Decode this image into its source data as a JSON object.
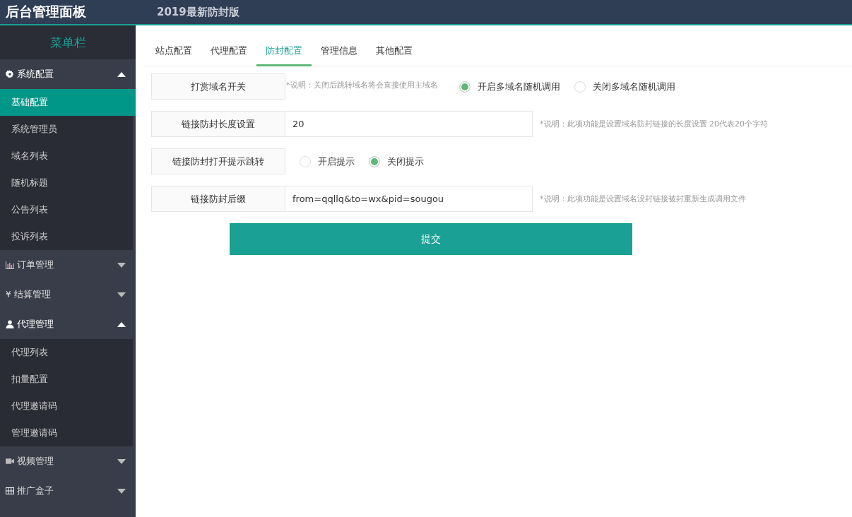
{
  "header": {
    "title": "后台管理面板",
    "subtitle": "2019最新防封版"
  },
  "sidebar": {
    "title": "菜单栏",
    "groups": [
      {
        "label": "系统配置",
        "kind": "gear",
        "expanded": true,
        "items": [
          {
            "label": "基础配置",
            "selected": true
          },
          {
            "label": "系统管理员",
            "selected": false
          },
          {
            "label": "域名列表",
            "selected": false
          },
          {
            "label": "随机标题",
            "selected": false
          },
          {
            "label": "公告列表",
            "selected": false
          },
          {
            "label": "投诉列表",
            "selected": false
          }
        ]
      },
      {
        "label": "订单管理",
        "kind": "chart",
        "expanded": false
      },
      {
        "label": "结算管理",
        "kind": "glyph",
        "glyph": "¥",
        "expanded": false
      },
      {
        "label": "代理管理",
        "kind": "user",
        "expanded": true,
        "items": [
          {
            "label": "代理列表",
            "selected": false
          },
          {
            "label": "扣量配置",
            "selected": false
          },
          {
            "label": "代理邀请码",
            "selected": false
          },
          {
            "label": "管理邀请码",
            "selected": false
          }
        ]
      },
      {
        "label": "视频管理",
        "kind": "video",
        "expanded": false
      },
      {
        "label": "推广盒子",
        "kind": "grid",
        "expanded": false
      }
    ]
  },
  "tabs": [
    {
      "label": "站点配置",
      "selected": false
    },
    {
      "label": "代理配置",
      "selected": false
    },
    {
      "label": "防封配置",
      "selected": true
    },
    {
      "label": "管理信息",
      "selected": false
    },
    {
      "label": "其他配置",
      "selected": false
    }
  ],
  "form": [
    {
      "kind": "radio",
      "label": "打赏域名开关",
      "note": "*说明：关闭后跳转域名将会直接使用主域名",
      "options": [
        {
          "label": "开启多域名随机调用",
          "selected": true
        },
        {
          "label": "关闭多域名随机调用",
          "selected": false
        }
      ]
    },
    {
      "kind": "input",
      "label": "链接防封长度设置",
      "value": "20",
      "note": "*说明：此项功能是设置域名防封链接的长度设置 20代表20个字符"
    },
    {
      "kind": "radio",
      "label": "链接防封打开提示跳转",
      "options": [
        {
          "label": "开启提示",
          "selected": false
        },
        {
          "label": "关闭提示",
          "selected": true
        }
      ]
    },
    {
      "kind": "input",
      "label": "链接防封后缀",
      "value": "from=qqllq&to=wx&pid=sougou",
      "note": "*说明：此项功能是设置域名没封链接被封重新生成调用文件"
    }
  ],
  "submit": "提交"
}
